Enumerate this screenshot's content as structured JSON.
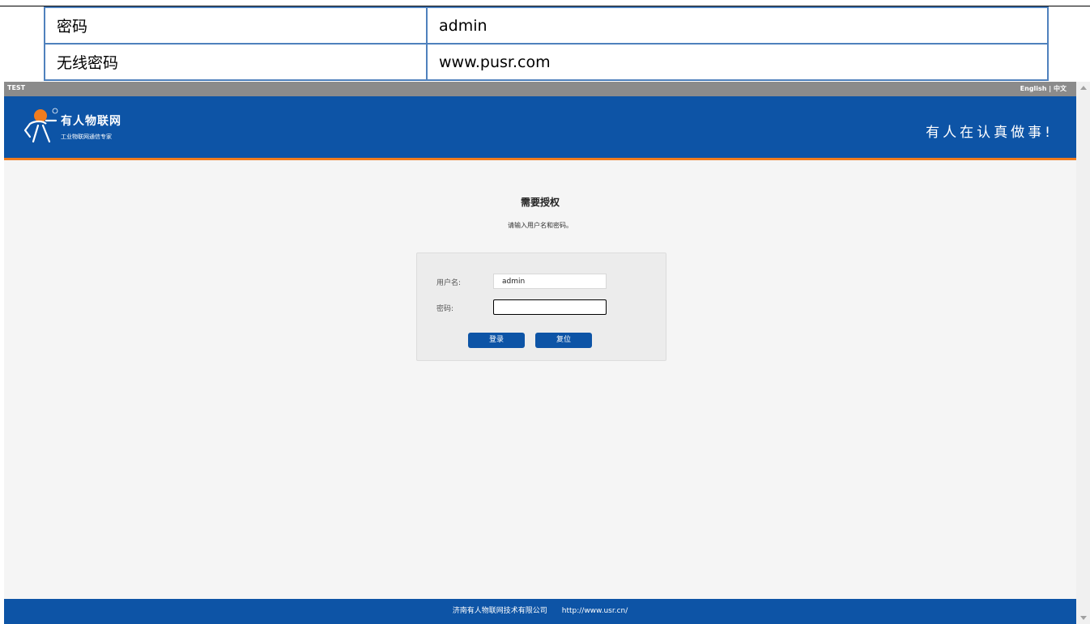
{
  "doc_table": {
    "rows": [
      {
        "key": "密码",
        "value": "admin"
      },
      {
        "key": "无线密码",
        "value": "www.pusr.com"
      }
    ]
  },
  "topbar": {
    "left": "TEST",
    "lang_en": "English",
    "separator": "|",
    "lang_zh": "中文"
  },
  "header": {
    "brand_name": "有人物联网",
    "brand_sub": "工业物联网通信专家",
    "slogan": "有人在认真做事!",
    "background_color": "#0d54a6",
    "accent_color": "#f07c1e"
  },
  "auth": {
    "title": "需要授权",
    "subtitle": "请输入用户名和密码。",
    "username_label": "用户名:",
    "username_value": "admin",
    "password_label": "密码:",
    "password_value": "",
    "login_button": "登录",
    "reset_button": "复位"
  },
  "footer": {
    "company": "济南有人物联网技术有限公司",
    "url": "http://www.usr.cn/"
  },
  "icons": {
    "logo": "usr-person-logo-icon",
    "scroll_up": "arrow-up-icon",
    "scroll_down": "arrow-down-icon"
  }
}
